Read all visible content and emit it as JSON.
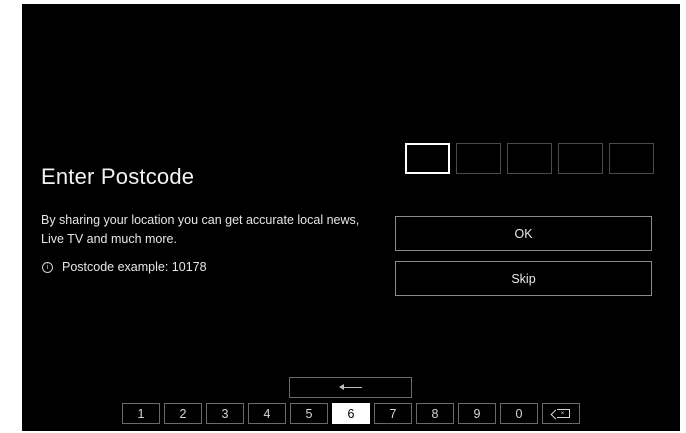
{
  "screen": {
    "title": "Enter Postcode",
    "description": "By sharing your location you can get accurate local news, Live TV and much more.",
    "hint": {
      "icon": "info-icon",
      "text": "Postcode example: 10178"
    }
  },
  "postcode_input": {
    "box_count": 5,
    "active_index": 0,
    "value": ""
  },
  "buttons": {
    "ok_label": "OK",
    "skip_label": "Skip"
  },
  "keyboard": {
    "enter_icon": "enter-arrow-icon",
    "keys": [
      "1",
      "2",
      "3",
      "4",
      "5",
      "6",
      "7",
      "8",
      "9",
      "0"
    ],
    "selected_key": "6",
    "backspace_icon": "backspace-icon"
  },
  "colors": {
    "background": "#000000",
    "text": "#ffffff",
    "selected_key_bg": "#ffffff"
  }
}
